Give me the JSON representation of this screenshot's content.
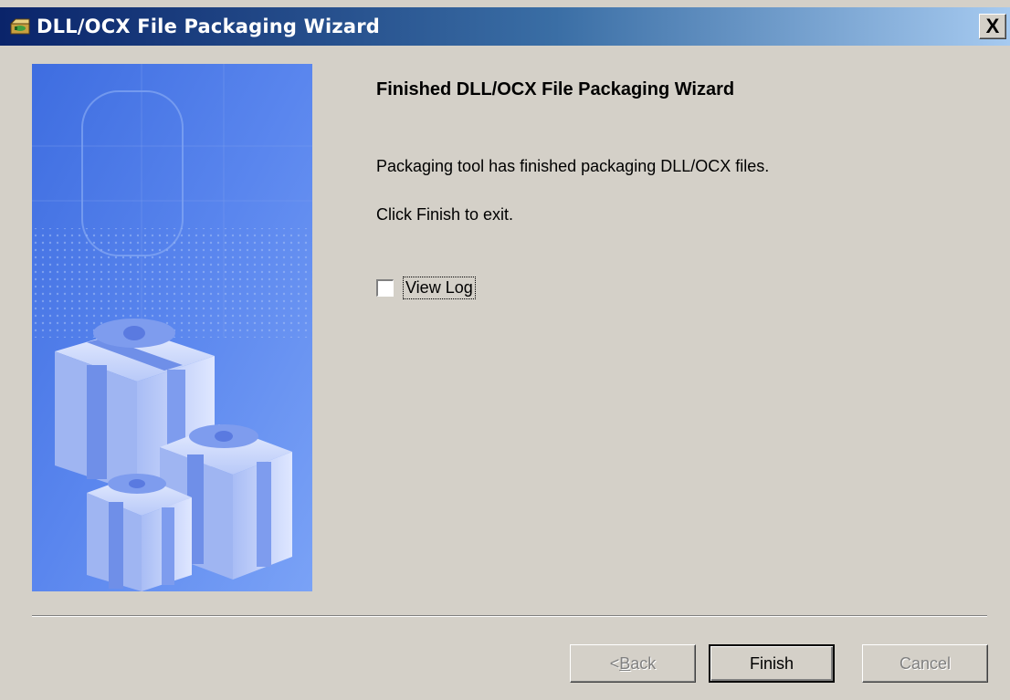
{
  "window": {
    "title": "DLL/OCX File Packaging Wizard",
    "close_symbol": "X",
    "icon": "packaging-box-icon"
  },
  "content": {
    "heading": "Finished DLL/OCX File Packaging Wizard",
    "line1": "Packaging tool has finished packaging DLL/OCX files.",
    "line2": "Click Finish to exit."
  },
  "checkbox": {
    "label": "View Log",
    "checked": false
  },
  "buttons": {
    "back_prefix": "< ",
    "back_accel": "B",
    "back_rest": "ack",
    "finish": "Finish",
    "cancel": "Cancel"
  },
  "colors": {
    "title_gradient_start": "#0a246a",
    "title_gradient_end": "#a6caf0",
    "dialog_bg": "#d4d0c8",
    "banner_blue": "#4a7ae8"
  }
}
